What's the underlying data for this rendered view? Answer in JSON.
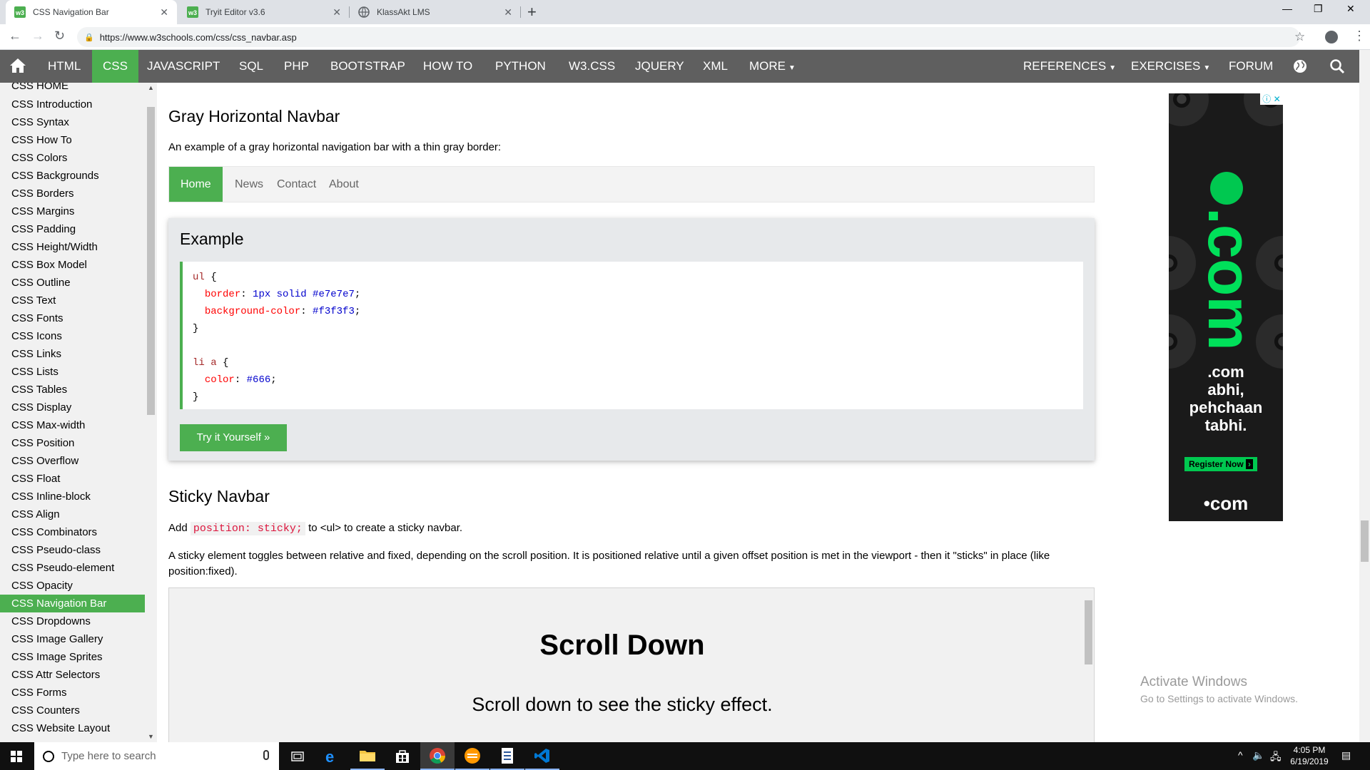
{
  "browser": {
    "tabs": [
      {
        "title": "CSS Navigation Bar",
        "active": true
      },
      {
        "title": "Tryit Editor v3.6",
        "active": false
      },
      {
        "title": "KlassAkt LMS",
        "active": false
      }
    ],
    "url": "https://www.w3schools.com/css/css_navbar.asp"
  },
  "topnav": {
    "items": [
      "HTML",
      "CSS",
      "JAVASCRIPT",
      "SQL",
      "PHP",
      "BOOTSTRAP",
      "HOW TO",
      "PYTHON",
      "W3.CSS",
      "JQUERY",
      "XML",
      "MORE"
    ],
    "active": "CSS",
    "right_items": [
      "REFERENCES",
      "EXERCISES",
      "FORUM"
    ],
    "accent": "#4caf50",
    "bar_color": "#5f5f5f"
  },
  "sidebar": {
    "items": [
      "CSS HOME",
      "CSS Introduction",
      "CSS Syntax",
      "CSS How To",
      "CSS Colors",
      "CSS Backgrounds",
      "CSS Borders",
      "CSS Margins",
      "CSS Padding",
      "CSS Height/Width",
      "CSS Box Model",
      "CSS Outline",
      "CSS Text",
      "CSS Fonts",
      "CSS Icons",
      "CSS Links",
      "CSS Lists",
      "CSS Tables",
      "CSS Display",
      "CSS Max-width",
      "CSS Position",
      "CSS Overflow",
      "CSS Float",
      "CSS Inline-block",
      "CSS Align",
      "CSS Combinators",
      "CSS Pseudo-class",
      "CSS Pseudo-element",
      "CSS Opacity",
      "CSS Navigation Bar",
      "CSS Dropdowns",
      "CSS Image Gallery",
      "CSS Image Sprites",
      "CSS Attr Selectors",
      "CSS Forms",
      "CSS Counters",
      "CSS Website Layout"
    ],
    "active": "CSS Navigation Bar"
  },
  "content": {
    "section1_title": "Gray Horizontal Navbar",
    "section1_desc": "An example of a gray horizontal navigation bar with a thin gray border:",
    "demo_nav": [
      "Home",
      "News",
      "Contact",
      "About"
    ],
    "example": {
      "title": "Example",
      "code": {
        "sel1": "ul",
        "p1": "border",
        "v1": "1px solid #e7e7e7",
        "p2": "background-color",
        "v2": "#f3f3f3",
        "sel2": "li a",
        "p3": "color",
        "v3": "#666"
      },
      "try_button": "Try it Yourself »"
    },
    "section2_title": "Sticky Navbar",
    "section2_p1_a": "Add",
    "section2_p1_code": "position: sticky;",
    "section2_p1_b": "to <ul> to create a sticky navbar.",
    "section2_p2": "A sticky element toggles between relative and fixed, depending on the scroll position. It is positioned relative until a given offset position is met in the viewport - then it \"sticks\" in place (like position:fixed).",
    "demo_heading": "Scroll Down",
    "demo_sub": "Scroll down to see the sticky effect."
  },
  "ad": {
    "big_text": ".com",
    "line1": ".com",
    "line2": "abhi,",
    "line3": "pehchaan",
    "line4": "tabhi.",
    "button": "Register Now",
    "footer": "•com"
  },
  "watermark": {
    "title": "Activate Windows",
    "sub": "Go to Settings to activate Windows."
  },
  "taskbar": {
    "search_placeholder": "Type here to search",
    "time": "4:05 PM",
    "date": "6/19/2019"
  }
}
